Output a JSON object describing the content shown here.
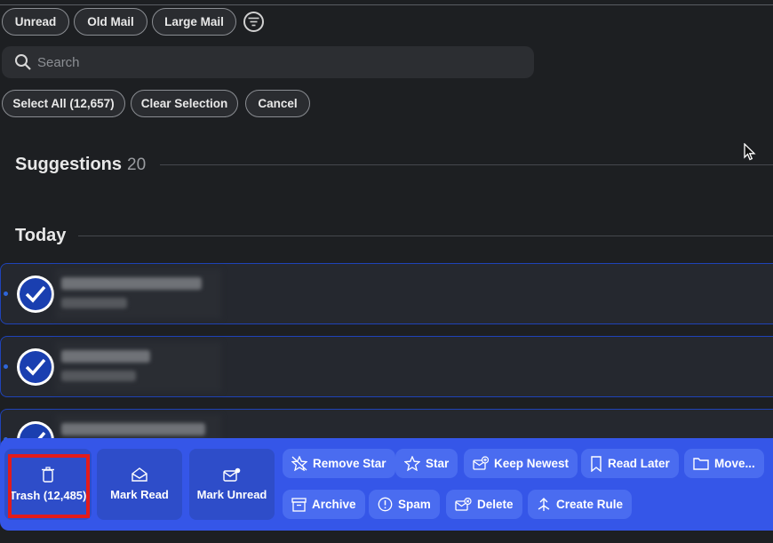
{
  "filters": {
    "chips": [
      "Unread",
      "Old Mail",
      "Large Mail"
    ],
    "icon": "filter-lines-icon"
  },
  "search": {
    "placeholder": "Search"
  },
  "selection": {
    "select_all": "Select All (12,657)",
    "clear": "Clear Selection",
    "cancel": "Cancel"
  },
  "suggestions": {
    "title": "Suggestions",
    "count": "20"
  },
  "today": {
    "title": "Today"
  },
  "actions": {
    "trash": "Trash (12,485)",
    "mark_read": "Mark Read",
    "mark_unread": "Mark Unread",
    "remove_star": "Remove Star",
    "star": "Star",
    "keep_newest": "Keep Newest",
    "read_later": "Read Later",
    "move": "Move...",
    "archive": "Archive",
    "spam": "Spam",
    "delete": "Delete",
    "create_rule": "Create Rule"
  },
  "colors": {
    "background": "#1d1f22",
    "action_bar": "#3556e8",
    "highlight": "#e21b1b",
    "selected_check": "#1a3fb0"
  }
}
